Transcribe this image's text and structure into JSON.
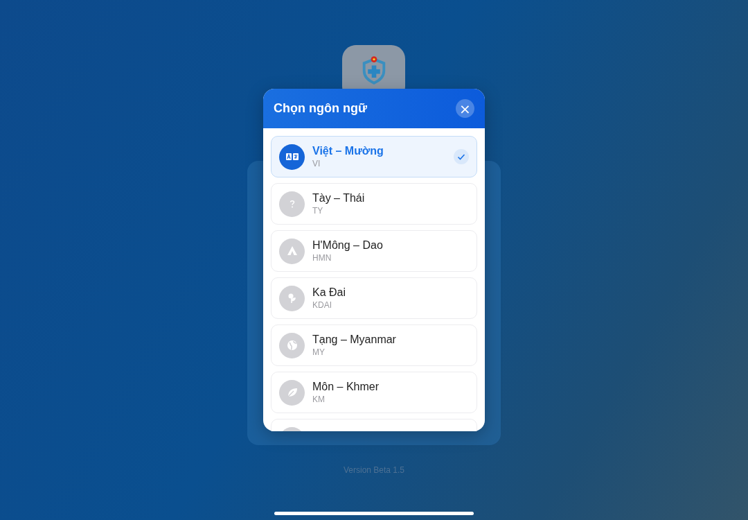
{
  "dialog": {
    "title": "Chọn ngôn ngữ",
    "close_label": "×"
  },
  "languages": [
    {
      "name": "Việt – Mường",
      "code": "VI",
      "kind": "translate",
      "selected": true
    },
    {
      "name": "Tày – Thái",
      "code": "TY",
      "kind": "question",
      "selected": false
    },
    {
      "name": "H'Mông – Dao",
      "code": "HMN",
      "kind": "tent",
      "selected": false
    },
    {
      "name": "Ka Đai",
      "code": "KDAI",
      "kind": "flower",
      "selected": false
    },
    {
      "name": "Tạng – Myanmar",
      "code": "MY",
      "kind": "globe",
      "selected": false
    },
    {
      "name": "Môn – Khmer",
      "code": "KM",
      "kind": "leaf",
      "selected": false
    }
  ],
  "partial_row": true,
  "version": "Version Beta 1.5"
}
